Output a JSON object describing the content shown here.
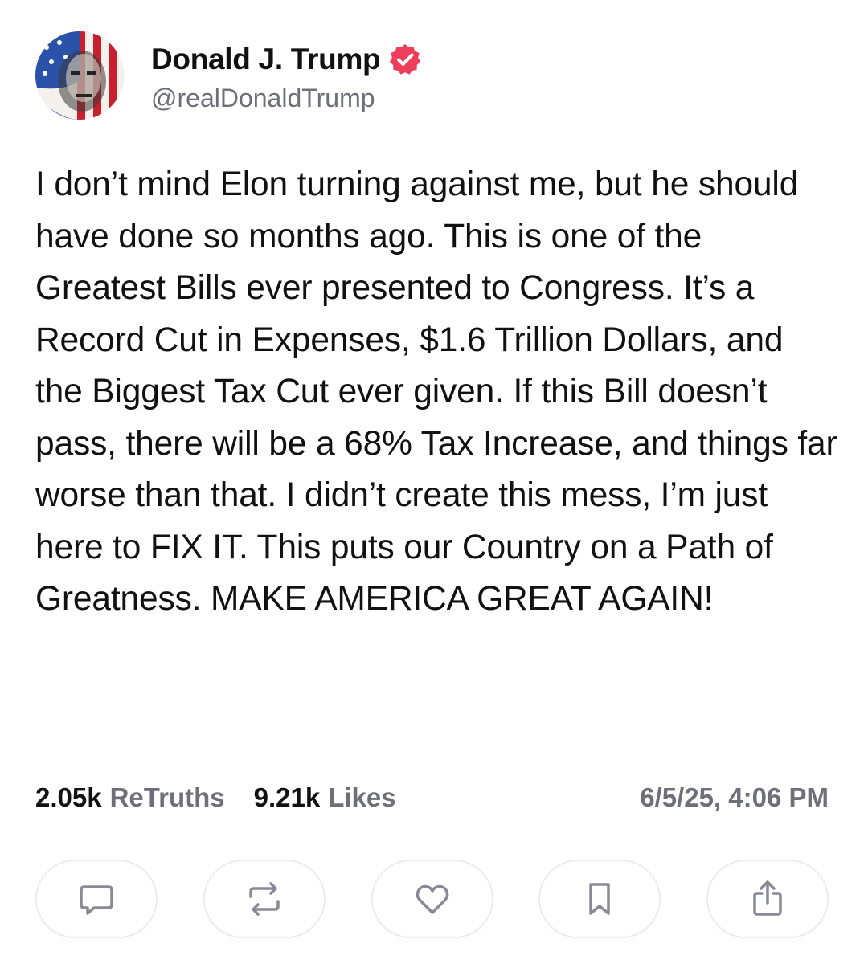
{
  "author": {
    "display_name": "Donald J. Trump",
    "handle": "@realDonaldTrump",
    "verified_icon": "verified-badge-icon",
    "verified_color": "#ef3e5c"
  },
  "post": {
    "text": "I don’t mind Elon turning against me, but he should have done so months ago. This is one of the Greatest Bills ever presented to Congress. It’s a Record Cut in Expenses, $1.6 Trillion Dollars, and the Biggest Tax Cut ever given. If this Bill doesn’t pass, there will be a 68% Tax Increase, and things far worse than that. I didn’t create this mess, I’m just here to FIX IT. This puts our Country on a Path of Greatness. MAKE AMERICA GREAT AGAIN!"
  },
  "stats": {
    "retruths_count": "2.05k",
    "retruths_label": "ReTruths",
    "likes_count": "9.21k",
    "likes_label": "Likes",
    "timestamp": "6/5/25, 4:06 PM"
  },
  "actions": [
    {
      "icon": "comment-icon"
    },
    {
      "icon": "retruth-icon"
    },
    {
      "icon": "heart-icon"
    },
    {
      "icon": "bookmark-icon"
    },
    {
      "icon": "share-icon"
    }
  ],
  "colors": {
    "text": "#111111",
    "muted": "#6f6f7a",
    "icon": "#8a8a96",
    "border": "#ececf0"
  }
}
